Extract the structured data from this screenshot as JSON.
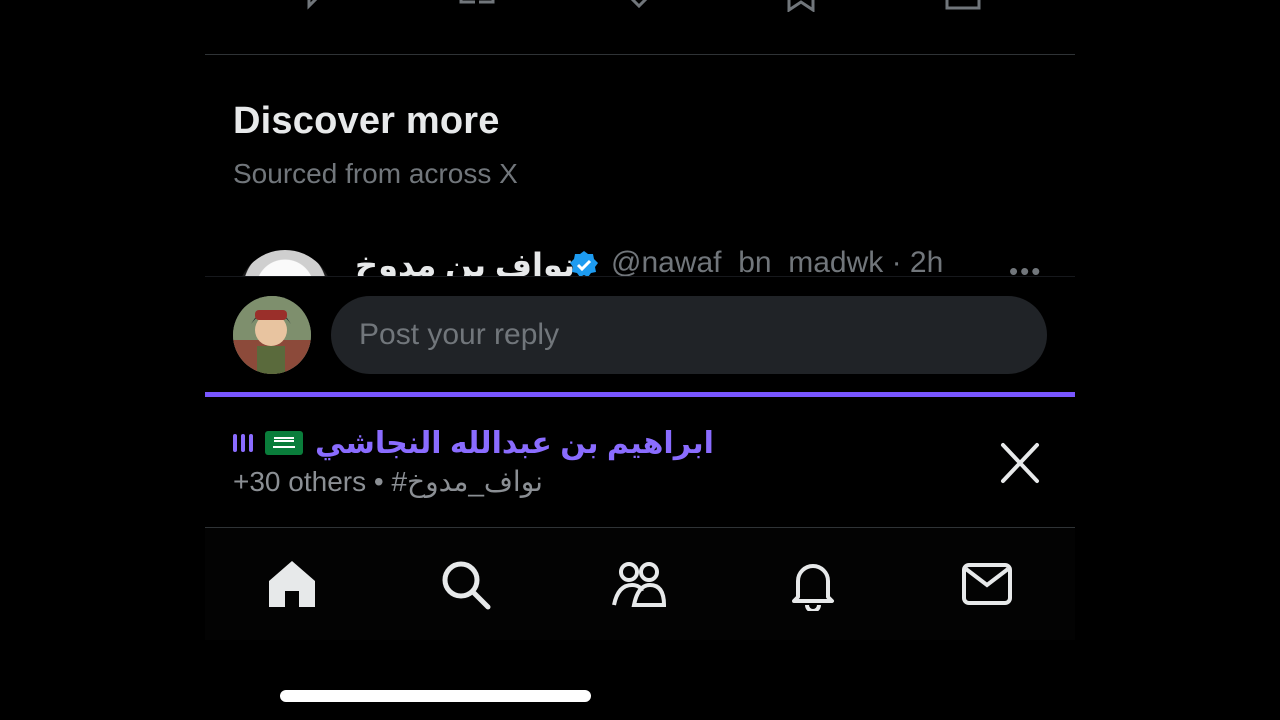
{
  "discover": {
    "title": "Discover more",
    "subtitle": "Sourced from across X"
  },
  "tweet_peek": {
    "display_name": "نواف بن مدوخ",
    "verified": true,
    "handle_time": "@nawaf_bn_madwk · 2h",
    "more_label": "•••"
  },
  "reply": {
    "placeholder": "Post your reply"
  },
  "banner": {
    "name": "ابراهيم بن عبدالله النجاشي",
    "subtitle": "+30 others • #نواف_مدوخ"
  },
  "nav": {
    "items": [
      "home",
      "search",
      "communities",
      "notifications",
      "messages"
    ]
  },
  "colors": {
    "accent": "#7856ff",
    "verified": "#1d9bf0",
    "background": "#000000",
    "muted_text": "#71767b"
  }
}
